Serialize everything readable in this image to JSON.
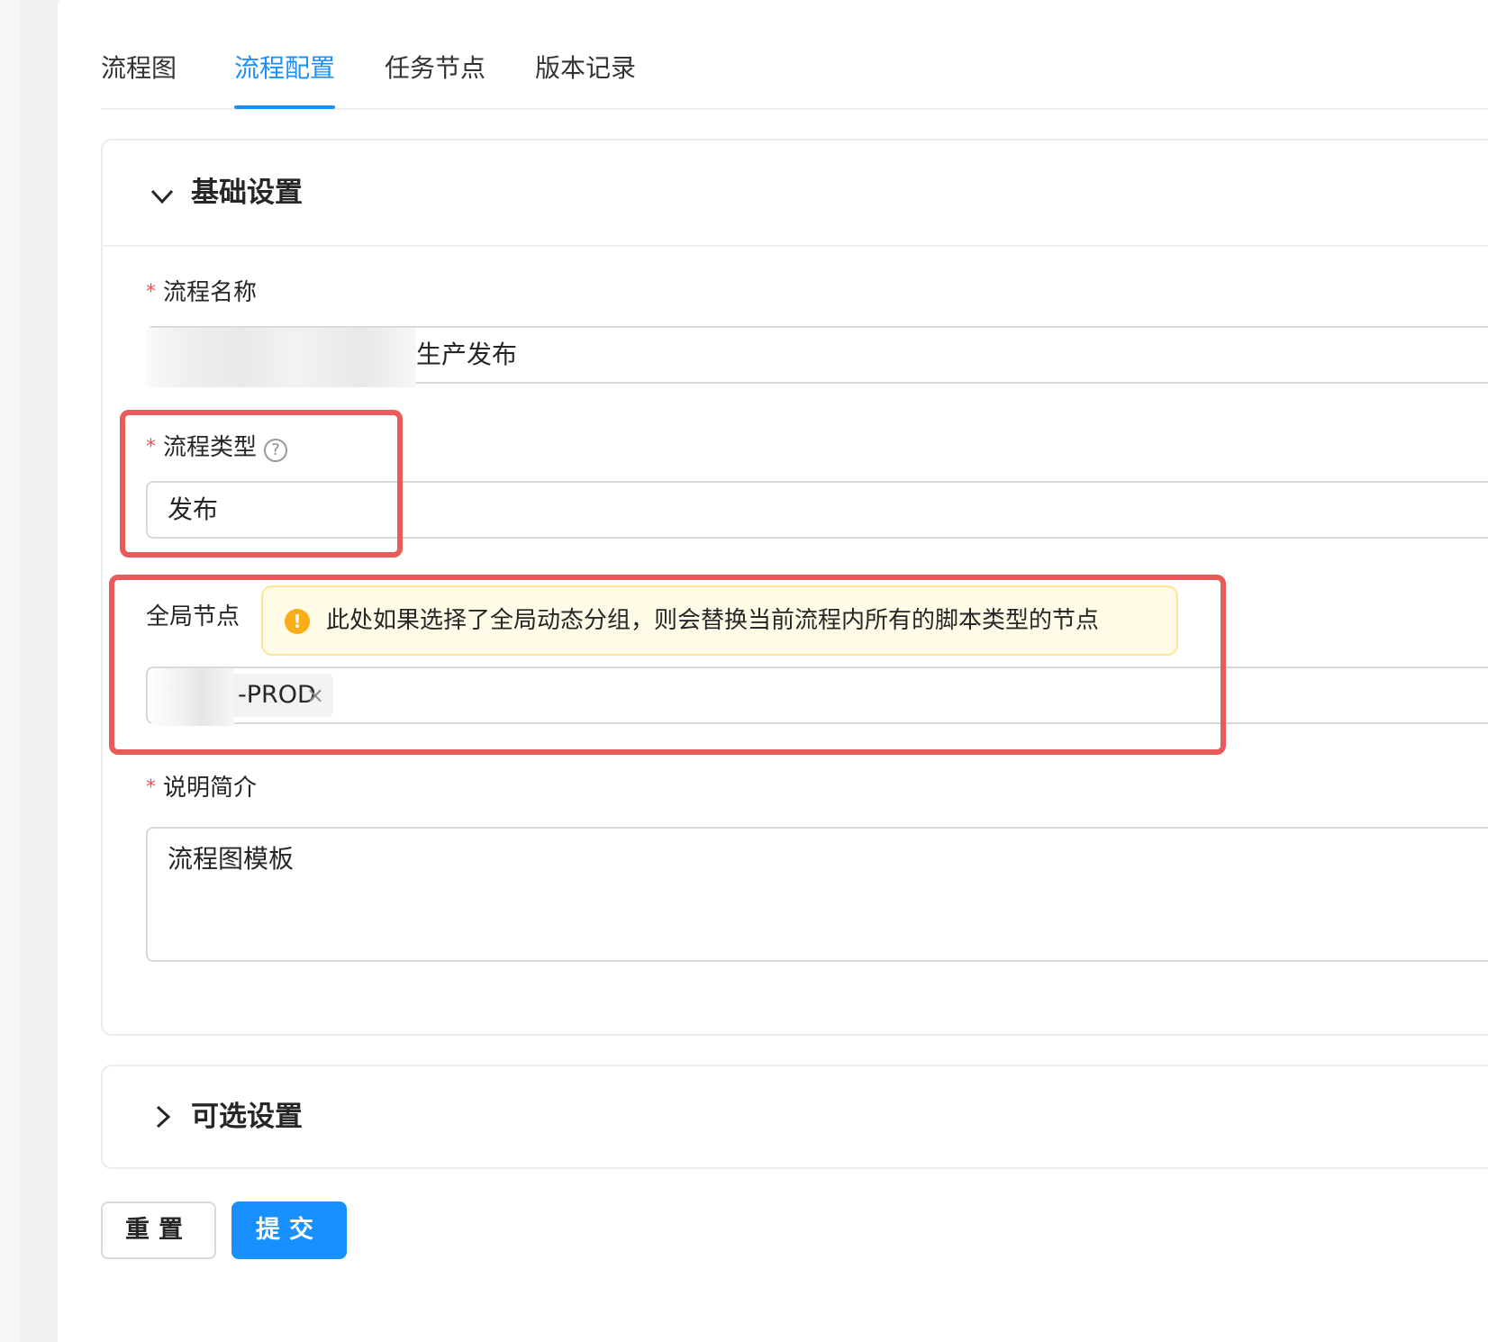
{
  "tabs": [
    {
      "label": "流程图"
    },
    {
      "label": "流程配置"
    },
    {
      "label": "任务节点"
    },
    {
      "label": "版本记录"
    }
  ],
  "active_tab": "流程配置",
  "basic_section": {
    "title": "基础设置",
    "name_label": "流程名称",
    "name_value": "生产发布",
    "type_label": "流程类型",
    "type_value": "发布",
    "global_label": "全局节点",
    "global_alert": "此处如果选择了全局动态分组，则会替换当前流程内所有的脚本类型的节点",
    "global_tag": "-PROD",
    "desc_label": "说明简介",
    "desc_value": "流程图模板"
  },
  "optional_section": {
    "title": "可选设置"
  },
  "buttons": {
    "reset": "重置",
    "submit": "提交"
  },
  "colors": {
    "primary": "#1890ff",
    "required": "#ff4d4f",
    "highlight": "#e95b5b",
    "warning": "#faad14"
  }
}
